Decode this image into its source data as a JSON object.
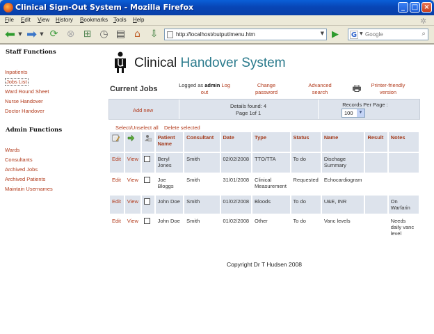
{
  "window": {
    "title": "Clinical Sign-Out System - Mozilla Firefox"
  },
  "menu": [
    "File",
    "Edit",
    "View",
    "History",
    "Bookmarks",
    "Tools",
    "Help"
  ],
  "toolbar": {
    "url": "http://localhost/output/menu.htm",
    "search_placeholder": "Google"
  },
  "sidebar": {
    "staff_heading": "Staff Functions",
    "staff_items": [
      {
        "label": "Inpatients"
      },
      {
        "label": "Jobs List"
      },
      {
        "label": "Ward Round Sheet"
      },
      {
        "label": "Nurse Handover"
      },
      {
        "label": "Doctor Handover"
      }
    ],
    "admin_heading": "Admin Functions",
    "admin_items": [
      {
        "label": "Wards"
      },
      {
        "label": "Consultants"
      },
      {
        "label": "Archived Jobs"
      },
      {
        "label": "Archived Patients"
      },
      {
        "label": "Maintain Usernames"
      }
    ]
  },
  "header": {
    "logo_word1": "Clinical",
    "logo_word2": "Handover System",
    "page_title": "Current Jobs",
    "logged_prefix": "Logged as",
    "username": "admin",
    "logout": "Log out",
    "change_password_1": "Change",
    "change_password_2": "password",
    "advanced_search_1": "Advanced",
    "advanced_search_2": "search",
    "printer_1": "Printer-friendly",
    "printer_2": "version"
  },
  "infobar": {
    "add_new": "Add new",
    "details_found": "Details found: 4",
    "page_info": "Page 1of 1",
    "records_label": "Records Per Page :",
    "records_value": "100"
  },
  "selection": {
    "select_all": "Select/Unselect all",
    "delete_selected": "Delete selected"
  },
  "table": {
    "columns": [
      "Patient Name",
      "Consultant",
      "Date",
      "Type",
      "Status",
      "Name",
      "Result",
      "Notes"
    ],
    "edit_label": "Edit",
    "view_label": "View",
    "rows": [
      {
        "patient": "Beryl Jones",
        "consultant": "Smith",
        "date": "02/02/2008",
        "type": "TTO/TTA",
        "status": "To do",
        "name": "Dischage Summary",
        "result": "",
        "notes": ""
      },
      {
        "patient": "Joe Bloggs",
        "consultant": "Smith",
        "date": "31/01/2008",
        "type": "Clinical Measurement",
        "status": "Requested",
        "name": "Echocardiogram",
        "result": "",
        "notes": ""
      },
      {
        "patient": "John Doe",
        "consultant": "Smith",
        "date": "01/02/2008",
        "type": "Bloods",
        "status": "To do",
        "name": "U&E, INR",
        "result": "",
        "notes": "On Warfarin"
      },
      {
        "patient": "John Doe",
        "consultant": "Smith",
        "date": "01/02/2008",
        "type": "Other",
        "status": "To do",
        "name": "Vanc levels",
        "result": "",
        "notes": "Needs daily vanc level"
      }
    ]
  },
  "footer": {
    "copyright": "Copyright Dr T Hudsen 2008"
  }
}
